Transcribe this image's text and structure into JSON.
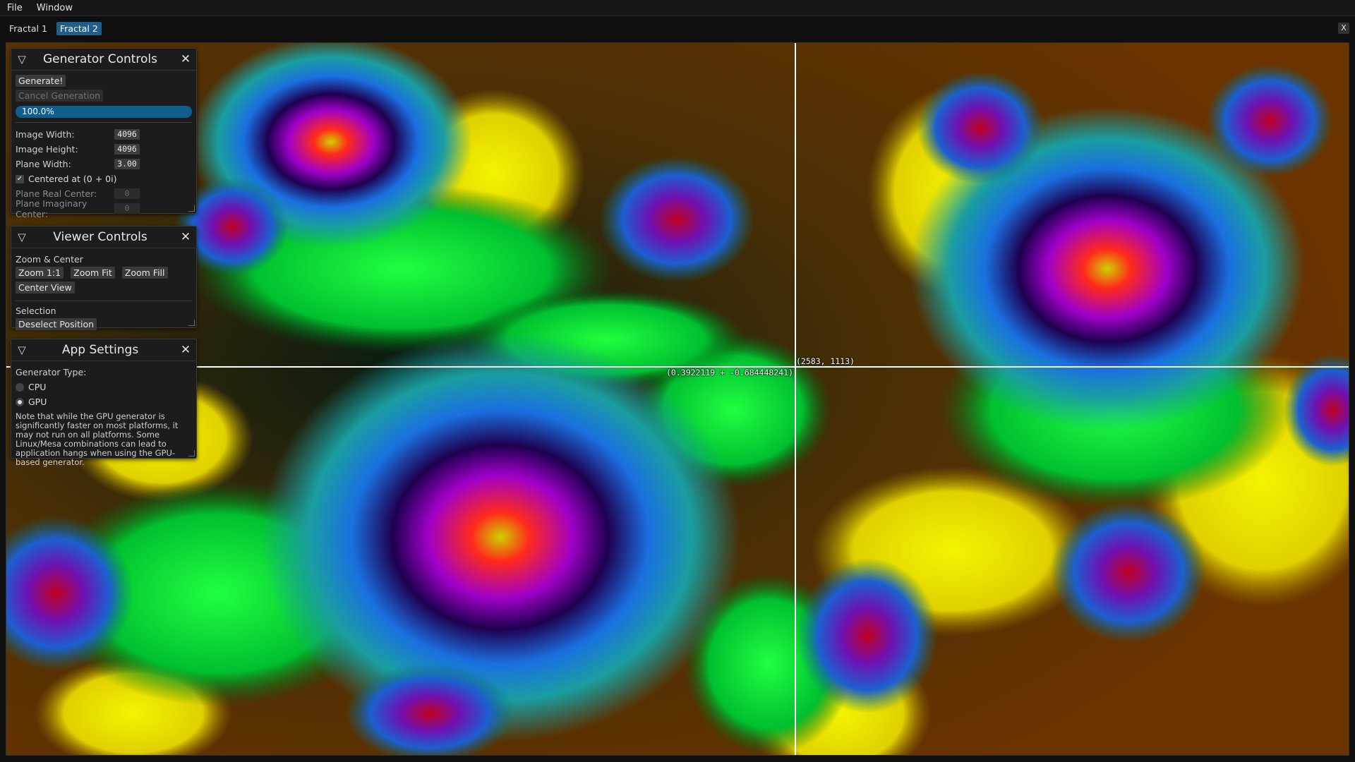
{
  "menu": {
    "items": [
      "File",
      "Window"
    ]
  },
  "tabs": {
    "items": [
      "Fractal 1",
      "Fractal 2"
    ],
    "active_index": 1,
    "close_label": "X"
  },
  "viewer": {
    "pixel_coord": "(2583, 1113)",
    "complex_coord": "(0.3922119 + -0.684448241)"
  },
  "generator_controls": {
    "title": "Generator Controls",
    "generate_label": "Generate!",
    "cancel_label": "Cancel Generation",
    "progress_text": "100.0%",
    "progress_fraction": 1.0,
    "image_width_label": "Image Width:",
    "image_width_value": "4096",
    "image_height_label": "Image Height:",
    "image_height_value": "4096",
    "plane_width_label": "Plane Width:",
    "plane_width_value": "3.00",
    "centered_label": "Centered at (0 + 0i)",
    "centered_checked": true,
    "plane_real_label": "Plane Real Center:",
    "plane_real_value": "0",
    "plane_imag_label": "Plane Imaginary Center:",
    "plane_imag_value": "0"
  },
  "viewer_controls": {
    "title": "Viewer Controls",
    "zoom_section": "Zoom & Center",
    "zoom_1_1": "Zoom 1:1",
    "zoom_fit": "Zoom Fit",
    "zoom_fill": "Zoom Fill",
    "center_view": "Center View",
    "selection_section": "Selection",
    "deselect": "Deselect Position"
  },
  "app_settings": {
    "title": "App Settings",
    "generator_type_label": "Generator Type:",
    "option_cpu": "CPU",
    "option_gpu": "GPU",
    "selected": "GPU",
    "note": "Note that while the GPU generator is significantly faster on most platforms, it may not run on all platforms. Some Linux/Mesa combinations can lead to application hangs when using the GPU-based generator."
  },
  "colors": {
    "accent": "#1e5f8d",
    "progress": "#0f5e8e",
    "panel_bg": "#1c1c1c"
  }
}
